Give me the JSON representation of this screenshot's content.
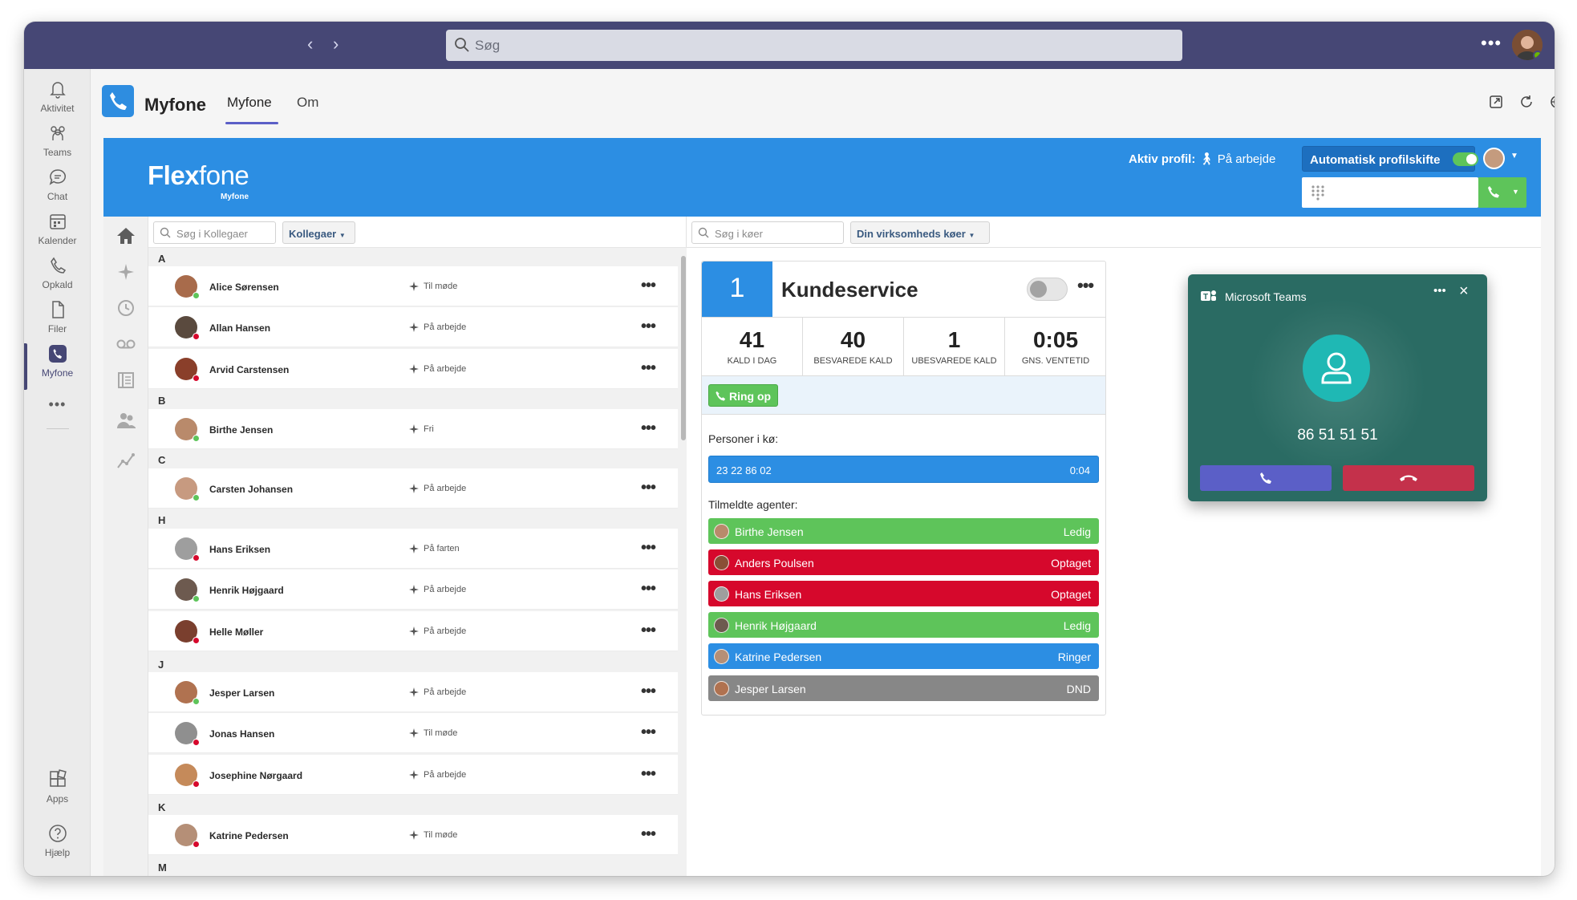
{
  "topbar": {
    "search_placeholder": "Søg",
    "more_label": "•••"
  },
  "rail": {
    "items": [
      {
        "label": "Aktivitet",
        "icon": "bell-icon"
      },
      {
        "label": "Teams",
        "icon": "teams-icon"
      },
      {
        "label": "Chat",
        "icon": "chat-icon"
      },
      {
        "label": "Kalender",
        "icon": "calendar-icon"
      },
      {
        "label": "Opkald",
        "icon": "phone-icon"
      },
      {
        "label": "Filer",
        "icon": "file-icon"
      },
      {
        "label": "Myfone",
        "icon": "myfone-icon"
      }
    ],
    "more_label": "•••",
    "apps_label": "Apps",
    "help_label": "Hjælp"
  },
  "app": {
    "name": "Myfone",
    "tabs": [
      "Myfone",
      "Om"
    ],
    "active_tab": "Myfone"
  },
  "flexfone": {
    "logo_main": "Flex",
    "logo_thin": "fone",
    "logo_sub": "Myfone",
    "active_profile_label": "Aktiv profil:",
    "active_profile_value": "På arbejde",
    "auto_switch_label": "Automatisk profilskifte",
    "auto_switch_on": true
  },
  "colleagues": {
    "search_placeholder": "Søg i Kollegaer",
    "filter_label": "Kollegaer",
    "groups": [
      {
        "letter": "A",
        "people": [
          {
            "name": "Alice Sørensen",
            "status": "Til møde",
            "presence": "available"
          },
          {
            "name": "Allan Hansen",
            "status": "På arbejde",
            "presence": "busy"
          },
          {
            "name": "Arvid Carstensen",
            "status": "På arbejde",
            "presence": "busy"
          }
        ]
      },
      {
        "letter": "B",
        "people": [
          {
            "name": "Birthe Jensen",
            "status": "Fri",
            "presence": "available"
          }
        ]
      },
      {
        "letter": "C",
        "people": [
          {
            "name": "Carsten Johansen",
            "status": "På arbejde",
            "presence": "available"
          }
        ]
      },
      {
        "letter": "H",
        "people": [
          {
            "name": "Hans Eriksen",
            "status": "På farten",
            "presence": "busy"
          },
          {
            "name": "Henrik Højgaard",
            "status": "På arbejde",
            "presence": "available"
          },
          {
            "name": "Helle Møller",
            "status": "På arbejde",
            "presence": "busy"
          }
        ]
      },
      {
        "letter": "J",
        "people": [
          {
            "name": "Jesper Larsen",
            "status": "På arbejde",
            "presence": "available"
          },
          {
            "name": "Jonas Hansen",
            "status": "Til møde",
            "presence": "busy"
          },
          {
            "name": "Josephine Nørgaard",
            "status": "På arbejde",
            "presence": "busy"
          }
        ]
      },
      {
        "letter": "K",
        "people": [
          {
            "name": "Katrine Pedersen",
            "status": "Til møde",
            "presence": "busy"
          }
        ]
      },
      {
        "letter": "M",
        "people": []
      }
    ]
  },
  "queues": {
    "search_placeholder": "Søg i køer",
    "filter_label": "Din virksomheds køer",
    "card": {
      "number": "1",
      "name": "Kundeservice",
      "enabled": false,
      "stats": [
        {
          "value": "41",
          "label": "KALD I DAG"
        },
        {
          "value": "40",
          "label": "BESVAREDE KALD"
        },
        {
          "value": "1",
          "label": "UBESVAREDE KALD"
        },
        {
          "value": "0:05",
          "label": "GNS. VENTETID"
        }
      ],
      "ring_label": "Ring op",
      "queue_label": "Personer i kø:",
      "callers": [
        {
          "number": "23 22 86 02",
          "wait": "0:04"
        }
      ],
      "agents_label": "Tilmeldte agenter:",
      "agents": [
        {
          "name": "Birthe Jensen",
          "status": "Ledig",
          "color": "#5ec45a"
        },
        {
          "name": "Anders Poulsen",
          "status": "Optaget",
          "color": "#d6082c"
        },
        {
          "name": "Hans Eriksen",
          "status": "Optaget",
          "color": "#d6082c"
        },
        {
          "name": "Henrik Højgaard",
          "status": "Ledig",
          "color": "#5ec45a"
        },
        {
          "name": "Katrine Pedersen",
          "status": "Ringer",
          "color": "#2c8ee3"
        },
        {
          "name": "Jesper Larsen",
          "status": "DND",
          "color": "#878787"
        }
      ]
    }
  },
  "incoming_call": {
    "title": "Microsoft Teams",
    "number": "86 51 51 51"
  },
  "colors": {
    "teams_purple": "#464775",
    "flexfone_blue": "#2c8ee3",
    "available_green": "#5ec45a",
    "busy_red": "#d6082c",
    "dnd_grey": "#878787",
    "call_popup": "#2a6b63"
  }
}
